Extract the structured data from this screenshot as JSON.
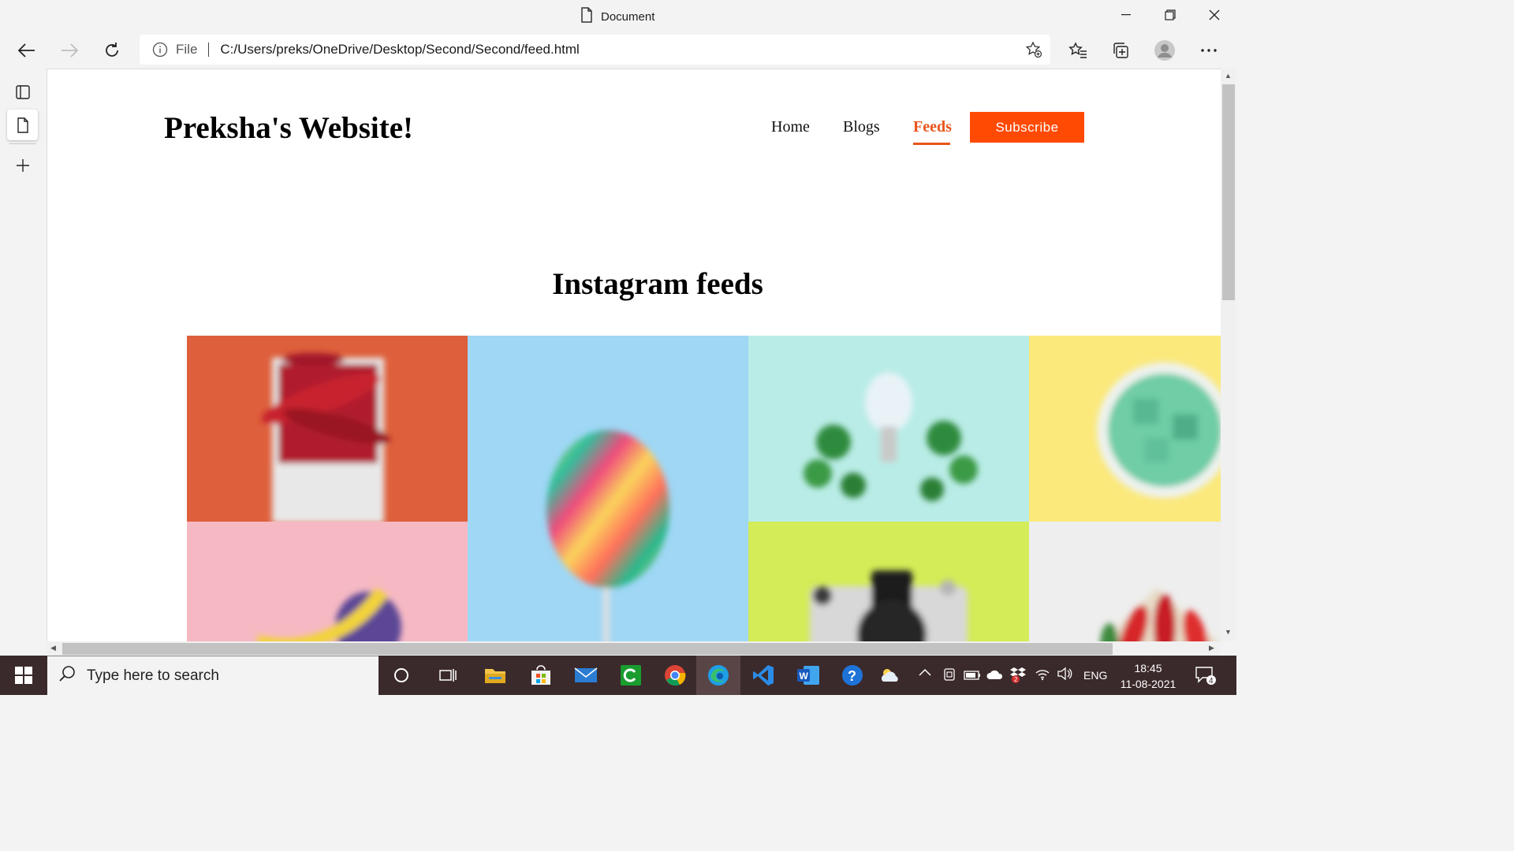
{
  "window": {
    "title": "Document"
  },
  "browser": {
    "protocol_label": "File",
    "url": "C:/Users/preks/OneDrive/Desktop/Second/Second/feed.html"
  },
  "page": {
    "site_title": "Preksha's Website!",
    "nav": [
      {
        "label": "Home"
      },
      {
        "label": "Blogs"
      },
      {
        "label": "Feeds",
        "active": true
      }
    ],
    "subscribe_label": "Subscribe",
    "heading": "Instagram feeds",
    "feed_images": [
      {
        "subject": "red chillies in white box",
        "bg": "#de5f3b"
      },
      {
        "subject": "rainbow lollipop",
        "bg": "#9fd7f5"
      },
      {
        "subject": "light bulb with plants",
        "bg": "#b9ece6"
      },
      {
        "subject": "bowl of green candy",
        "bg": "#fbe97c"
      },
      {
        "subject": "banana",
        "bg": "#f6b9c4"
      },
      {
        "subject": "camera",
        "bg": "#d3ec57"
      },
      {
        "subject": "red peppers",
        "bg": "#eeeeee"
      }
    ],
    "accent_color": "#ff4a04"
  },
  "taskbar": {
    "search_placeholder": "Type here to search",
    "language": "ENG",
    "time": "18:45",
    "date": "11-08-2021",
    "notification_count": "4",
    "tray_badge": "2"
  }
}
